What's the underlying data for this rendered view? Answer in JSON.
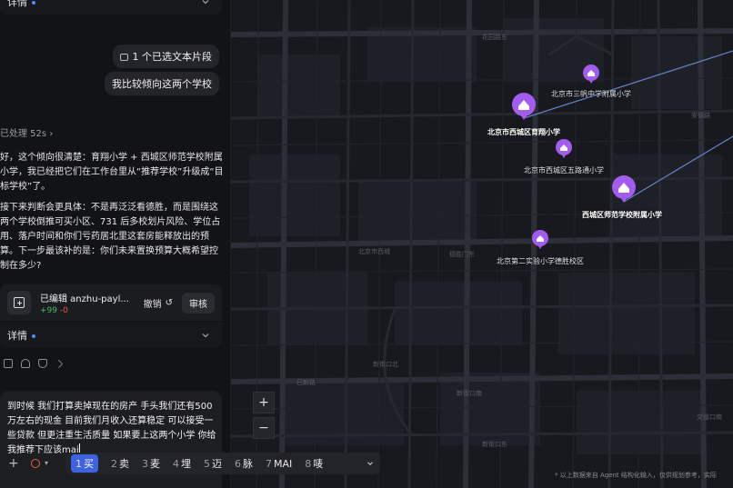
{
  "chat": {
    "details_label_top": "详情",
    "selected_fragment": "1 个已选文本片段",
    "user_message": "我比较倾向这两个学校",
    "processed": "已处理 52s",
    "para1": "好，这个倾向很清楚：育翔小学 + 西城区师范学校附属小学，我已经把它们在工作台里从“推荐学校”升级成“目标学校”了。",
    "para2": "接下来判断会更具体：不是再泛泛看德胜，而是围绕这两个学校倒推可买小区、731 后多校划片风险、学位占用、落户时间和你们亏药居北里这套房能释放出的预算。下一步最该补的是：你们未来置换预算大概希望控制在多少?",
    "edit_title": "已编辑 anzhu-payl...",
    "edit_plus": "+99",
    "edit_minus": "-0",
    "undo_label": "撤销",
    "review_label": "审核",
    "details_label": "详情",
    "input_text": "到时候 我们打算卖掉现在的房产 手头我们还有500万左右的现金 目前我们月收入还算稳定 可以接受一些贷款 但更注重生活质量 如果要上这两个小学 你给我推荐下应该mai"
  },
  "ime": {
    "candidates": [
      {
        "n": "1",
        "t": "买"
      },
      {
        "n": "2",
        "t": "卖"
      },
      {
        "n": "3",
        "t": "麦"
      },
      {
        "n": "4",
        "t": "埋"
      },
      {
        "n": "5",
        "t": "迈"
      },
      {
        "n": "6",
        "t": "脉"
      },
      {
        "n": "7",
        "t": "MAI"
      },
      {
        "n": "8",
        "t": "唛"
      }
    ]
  },
  "map": {
    "pins": [
      {
        "label": "北京市三帆中学附属小学",
        "size": "small"
      },
      {
        "label": "北京市西城区育翔小学",
        "size": "big"
      },
      {
        "label": "北京市西城区五路通小学",
        "size": "small"
      },
      {
        "label": "西城区师范学校附属小学",
        "size": "big"
      },
      {
        "label": "北京第二实验小学德胜校区",
        "size": "small"
      }
    ],
    "road_labels": [
      "花园路东",
      "北京市西城",
      "德胜门东",
      "安德路",
      "新街口北",
      "新街口南",
      "新街口东",
      "交道口南",
      "已新路"
    ],
    "zoom_in": "+",
    "zoom_out": "−",
    "note": "* 以上数据来自 Agent 结构化输入，仅供规划参考，实际",
    "colors": {
      "pin": "#a45cf0",
      "line": "#6f8fd9"
    }
  }
}
